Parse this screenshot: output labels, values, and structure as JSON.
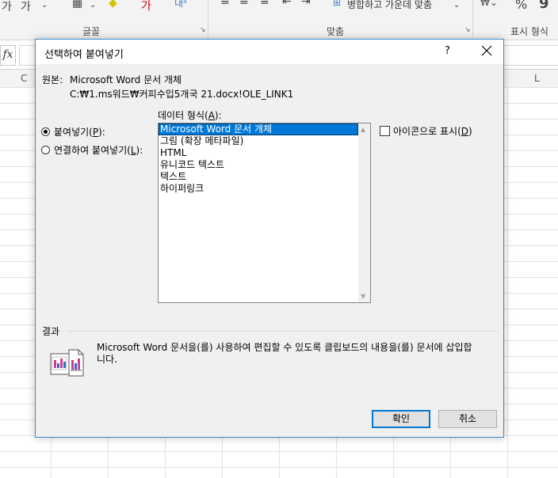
{
  "excel": {
    "ribbon": {
      "font_group_label": "글꼴",
      "alignment_group_label": "맞춤",
      "number_group_label": "표시 형식",
      "merge_button_label": "병합하고 가운데 맞춤",
      "percent_symbol": "%",
      "comma_symbol": "9",
      "launcher_symbol": "↘"
    },
    "formula_bar": {
      "fx_label": "fx"
    },
    "columns": [
      "C",
      "L"
    ]
  },
  "dialog": {
    "title": "선택하여 붙여넣기",
    "help_symbol": "?",
    "source_label": "원본:",
    "source_name": "Microsoft Word 문서 개체",
    "source_path": "C:₩1.ms워드₩커피수입5개국 21.docx!OLE_LINK1",
    "paste_option": {
      "text": "붙여넣기(",
      "key": "P",
      "suffix": "):",
      "selected": true
    },
    "paste_link_option": {
      "text": "연결하여 붙여넣기(",
      "key": "L",
      "suffix": "):",
      "selected": false
    },
    "format_label": {
      "text": "데이터 형식(",
      "key": "A",
      "suffix": "):"
    },
    "formats": [
      "Microsoft Word 문서 개체",
      "그림 (확장 메타파일)",
      "HTML",
      "유니코드 텍스트",
      "텍스트",
      "하이퍼링크"
    ],
    "selected_format_index": 0,
    "display_as_icon": {
      "text": "아이콘으로 표시(",
      "key": "D",
      "suffix": ")",
      "checked": false
    },
    "result_label": "결과",
    "result_text": "Microsoft Word 문서을(를) 사용하여 편집할 수 있도록 클립보드의 내용을(를) 문서에 삽입합니다.",
    "ok_label": "확인",
    "cancel_label": "취소"
  },
  "colors": {
    "selection": "#0078d7",
    "dialog_border": "#3c8bc7",
    "dialog_bg": "#f0f0f0"
  }
}
